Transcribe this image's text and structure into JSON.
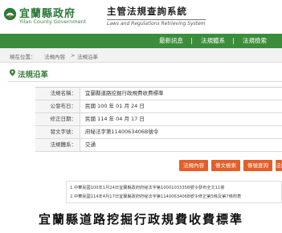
{
  "header": {
    "logo_zh": "宜蘭縣政府",
    "logo_en": "Yilan County Government",
    "site_zh": "主管法規查詢系統",
    "site_en": "Laws and Regulations Retrieving System",
    "brand_color": "#2a7a3a"
  },
  "nav": {
    "items": [
      "最新訊息",
      "法規體系",
      "法規檢索"
    ]
  },
  "breadcrumb": {
    "current_label": "現在位置：",
    "path": [
      "法規內容",
      "法規沿革"
    ],
    "separator": ">"
  },
  "section": {
    "title": "法規沿革"
  },
  "details": {
    "rows": [
      {
        "label": "法規名稱：",
        "value": "宜蘭縣道路挖掘行政規費收費標準"
      },
      {
        "label": "公發布日：",
        "value": "民國 100 年 01 月 24 日"
      },
      {
        "label": "修正日期：",
        "value": "民國 114 年 04 月 17 日"
      },
      {
        "label": "發文字號：",
        "value": "府秘法字第1140063406B號令"
      },
      {
        "label": "法規體系：",
        "value": "交通"
      }
    ]
  },
  "buttons": {
    "items": [
      "法規內容",
      "條文檢索",
      "條號查詢",
      "法規沿"
    ]
  },
  "notes": {
    "lines": [
      "1.中華民國100年1月24日宜蘭縣政府府秘法字第1000103335B號令發布全文11條",
      "2.中華民國114年4月17日宜蘭縣政府府秘法字第1140063406B號令修正第5條及第7條附表"
    ]
  },
  "caption": {
    "text": "宜蘭縣道路挖掘行政規費收費標準"
  },
  "colors": {
    "nav_green": "#3b8c3b",
    "button_orange": "#e45e28",
    "title_green": "#3b7d3b"
  }
}
